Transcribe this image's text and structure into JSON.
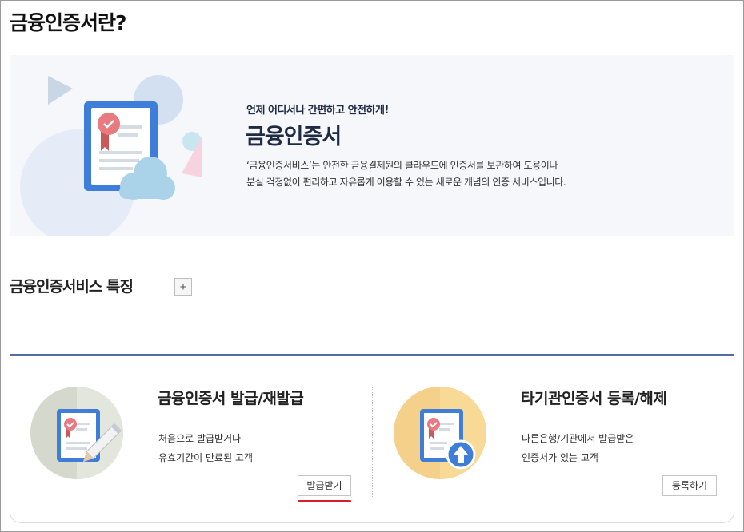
{
  "page": {
    "title": "금융인증서란?"
  },
  "hero": {
    "subtitle": "언제 어디서나 간편하고 안전하게!",
    "title": "금융인증서",
    "desc_line1": "‘금융인증서비스’는 안전한 금융결제원의 클라우드에 인증서를 보관하여 도용이나",
    "desc_line2": "분실 걱정없이 편리하고 자유롭게 이용할 수 있는 새로운 개념의 인증 서비스입니다."
  },
  "features": {
    "title": "금융인증서비스 특징",
    "expand_label": "+"
  },
  "cards": [
    {
      "title": "금융인증서 발급/재발급",
      "desc_line1": "처음으로 발급받거나",
      "desc_line2": "유효기간이 만료된 고객",
      "button": "발급받기",
      "icon": "certificate-pencil-icon"
    },
    {
      "title": "타기관인증서 등록/해제",
      "desc_line1": "다른은행/기관에서 발급받은",
      "desc_line2": "인증서가 있는 고객",
      "button": "등록하기",
      "icon": "certificate-upload-icon"
    }
  ],
  "colors": {
    "accent_border": "#4f6fa0",
    "highlight_underline": "#d6202b",
    "hero_background": "#f6f7fb",
    "title_navy": "#1f2a44"
  }
}
